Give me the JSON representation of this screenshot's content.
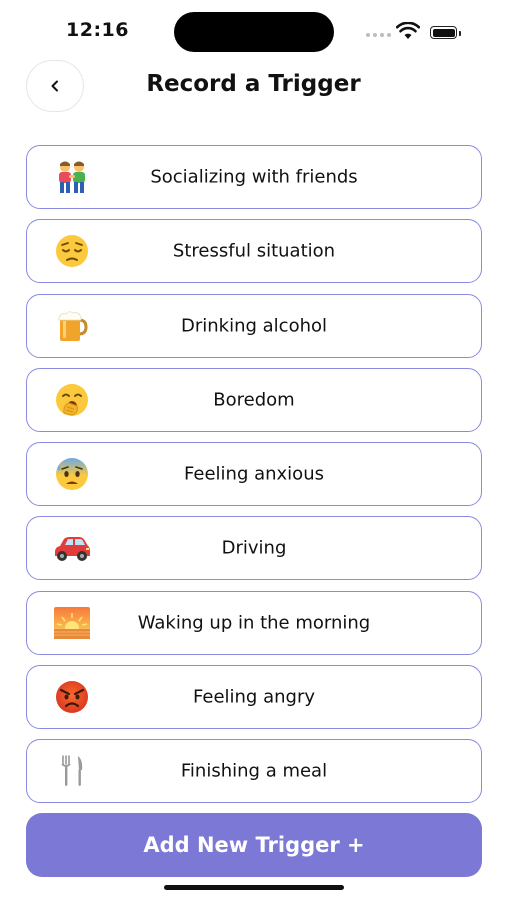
{
  "status_bar": {
    "time": "12:16"
  },
  "header": {
    "title": "Record a Trigger",
    "back_icon": "chevron-left-icon"
  },
  "triggers": [
    {
      "label": "Socializing with friends",
      "icon": "two-people-icon"
    },
    {
      "label": "Stressful situation",
      "icon": "pensive-face-icon"
    },
    {
      "label": "Drinking alcohol",
      "icon": "beer-mug-icon"
    },
    {
      "label": "Boredom",
      "icon": "yawning-face-icon"
    },
    {
      "label": "Feeling anxious",
      "icon": "anxious-sweat-face-icon"
    },
    {
      "label": "Driving",
      "icon": "red-car-icon"
    },
    {
      "label": "Waking up in the morning",
      "icon": "sunrise-icon"
    },
    {
      "label": "Feeling angry",
      "icon": "angry-face-icon"
    },
    {
      "label": "Finishing a meal",
      "icon": "fork-knife-icon"
    }
  ],
  "actions": {
    "add_trigger_label": "Add New Trigger +"
  },
  "colors": {
    "accent": "#7b78d6",
    "border": "#8c8ae0"
  }
}
